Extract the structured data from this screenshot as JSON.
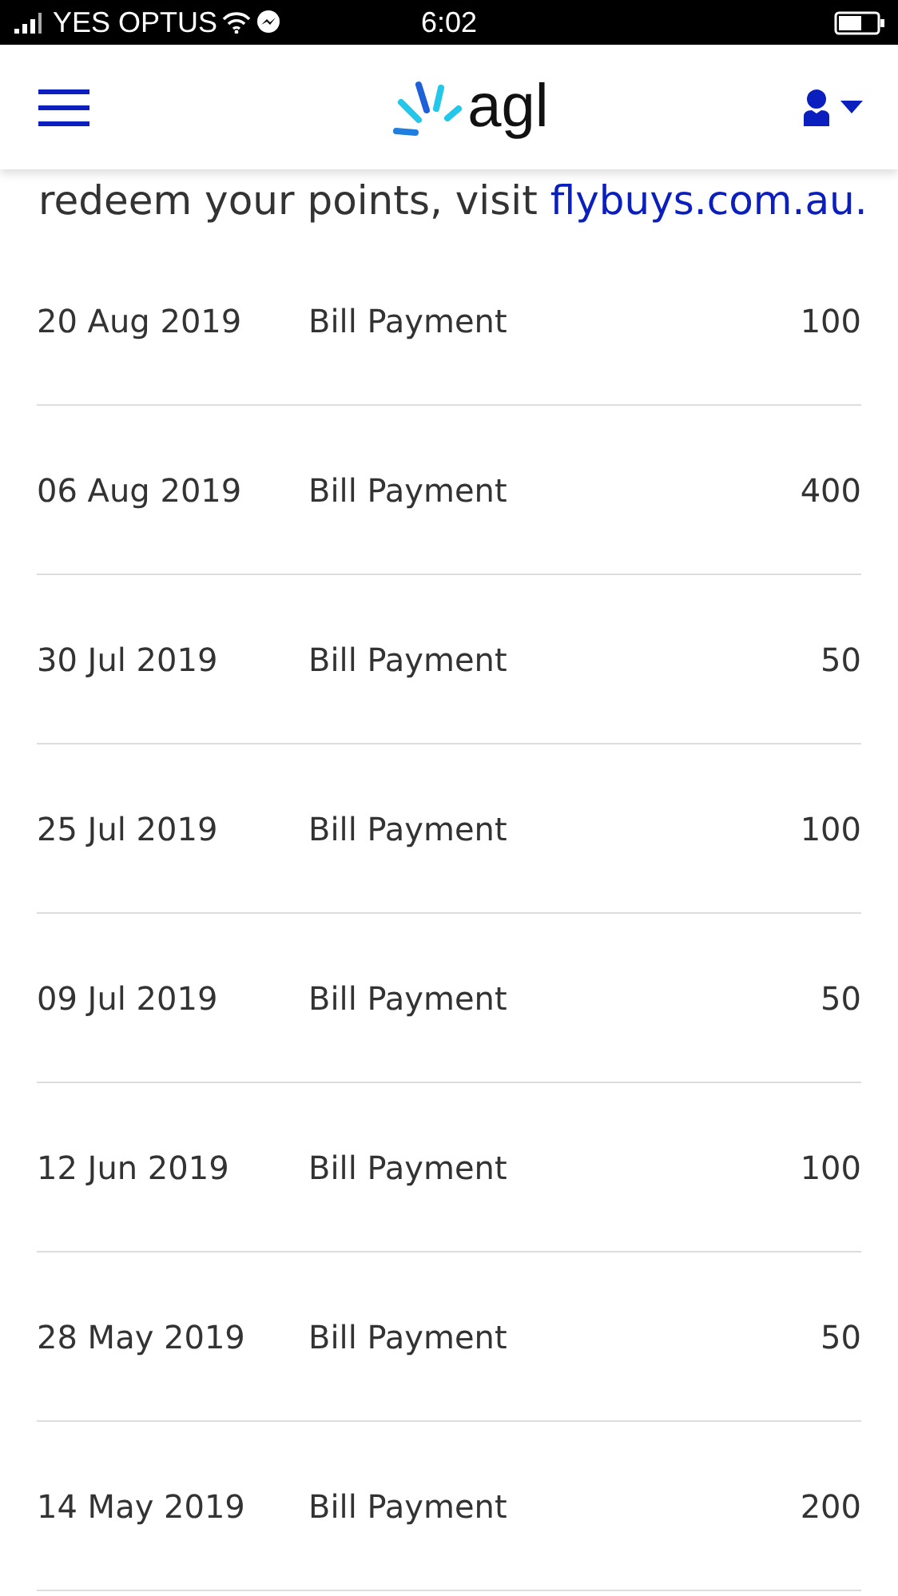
{
  "status_bar": {
    "carrier": "YES OPTUS",
    "time": "6:02"
  },
  "header": {
    "logo": "agl"
  },
  "intro": {
    "text": "redeem your points, visit ",
    "link": "flybuys.com.au."
  },
  "transactions": [
    {
      "date": "20 Aug 2019",
      "description": "Bill Payment",
      "points": "100"
    },
    {
      "date": "06 Aug 2019",
      "description": "Bill Payment",
      "points": "400"
    },
    {
      "date": "30 Jul 2019",
      "description": "Bill Payment",
      "points": "50"
    },
    {
      "date": "25 Jul 2019",
      "description": "Bill Payment",
      "points": "100"
    },
    {
      "date": "09 Jul 2019",
      "description": "Bill Payment",
      "points": "50"
    },
    {
      "date": "12 Jun 2019",
      "description": "Bill Payment",
      "points": "100"
    },
    {
      "date": "28 May 2019",
      "description": "Bill Payment",
      "points": "50"
    },
    {
      "date": "14 May 2019",
      "description": "Bill Payment",
      "points": "200"
    }
  ]
}
